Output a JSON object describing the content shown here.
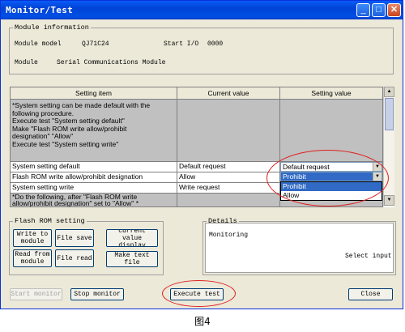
{
  "window": {
    "title": "Monitor/Test",
    "min_label": "_",
    "max_label": "□",
    "close_label": "✕"
  },
  "module_info": {
    "legend": "Module information",
    "model_label": "Module model",
    "model_value": "QJ71C24",
    "start_io_label": "Start I/O",
    "start_io_value": "0000",
    "module_label": "Module",
    "module_value": "Serial Communications Module"
  },
  "table": {
    "headers": [
      "Setting item",
      "Current value",
      "Setting value"
    ],
    "intro_lines": [
      "*System setting can be made default with the",
      "following procedure.",
      "Execute test \"System setting default\"",
      "Make \"Flash ROM write allow/prohibit",
      "designation\" \"Allow\"",
      "Execute test \"System setting write\""
    ],
    "rows": [
      {
        "item": "System setting default",
        "current": "Default request",
        "setting": "Default request"
      },
      {
        "item": "Flash ROM write allow/prohibit designation",
        "current": "Allow",
        "setting": "Prohibit"
      },
      {
        "item": "System setting write",
        "current": "Write request",
        "setting": ""
      }
    ],
    "footer_lines": [
      "*Do the following, after \"Flash ROM write",
      "allow/prohibit designation\" set to \"Allow\" *"
    ],
    "dropdown_options": [
      "Prohibit",
      "Allow"
    ]
  },
  "flash_rom": {
    "legend": "Flash ROM setting",
    "write_to_module": "Write to module",
    "file_save": "File save",
    "read_from_module": "Read from module",
    "file_read": "File read",
    "current_value_display": "Current value display",
    "make_text_file": "Make text file"
  },
  "details": {
    "legend": "Details",
    "status": "Monitoring",
    "hint": "Select input"
  },
  "buttons": {
    "start_monitor": "Start monitor",
    "stop_monitor": "Stop monitor",
    "execute_test": "Execute test",
    "close": "Close"
  },
  "caption": "图4",
  "colors": {
    "titlebar": "#0054e3",
    "selection": "#316ac5",
    "annotation": "#e02020"
  }
}
